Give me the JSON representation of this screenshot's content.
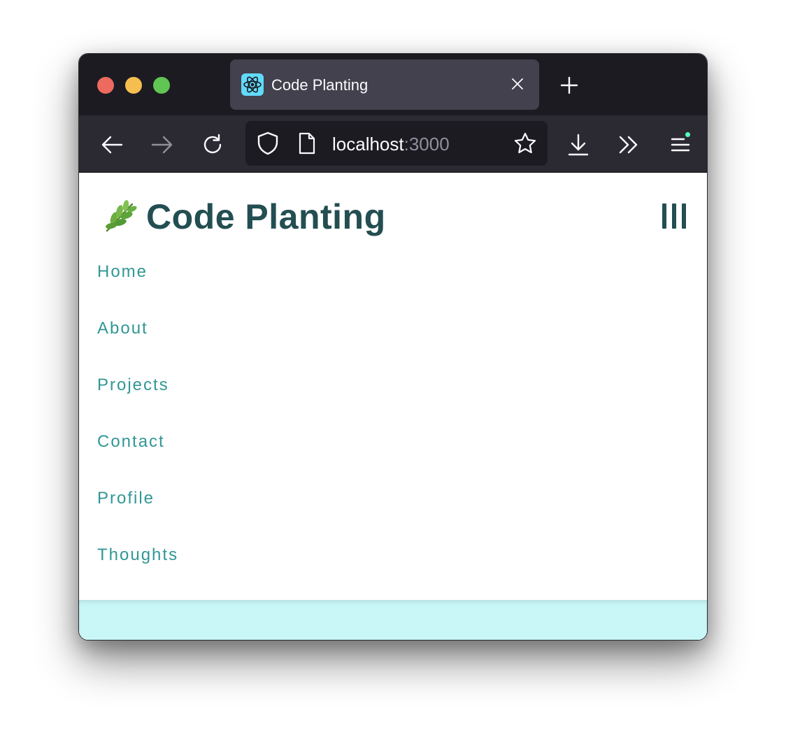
{
  "browser": {
    "traffic_lights": {
      "close_color": "#ed6a5e",
      "minimize_color": "#f5bf4f",
      "maximize_color": "#61c554"
    },
    "tab": {
      "title": "Code Planting",
      "favicon": "react-atom-icon"
    },
    "toolbar": {
      "back_icon": "arrow-left-icon",
      "forward_icon": "arrow-right-icon",
      "reload_icon": "reload-icon",
      "shield_icon": "shield-icon",
      "page_icon": "document-icon",
      "bookmark_icon": "star-icon",
      "download_icon": "download-icon",
      "overflow_icon": "chevrons-right-icon",
      "menu_icon": "hamburger-menu-icon"
    },
    "url": {
      "host": "localhost",
      "port": ":3000"
    }
  },
  "site": {
    "brand_emoji": "herb-emoji",
    "brand_title": "Code Planting",
    "accent_color": "#319795",
    "heading_color": "#234e52",
    "footer_color": "#c9f7f7",
    "nav": [
      {
        "label": "Home"
      },
      {
        "label": "About"
      },
      {
        "label": "Projects"
      },
      {
        "label": "Contact"
      },
      {
        "label": "Profile"
      },
      {
        "label": "Thoughts"
      }
    ]
  }
}
